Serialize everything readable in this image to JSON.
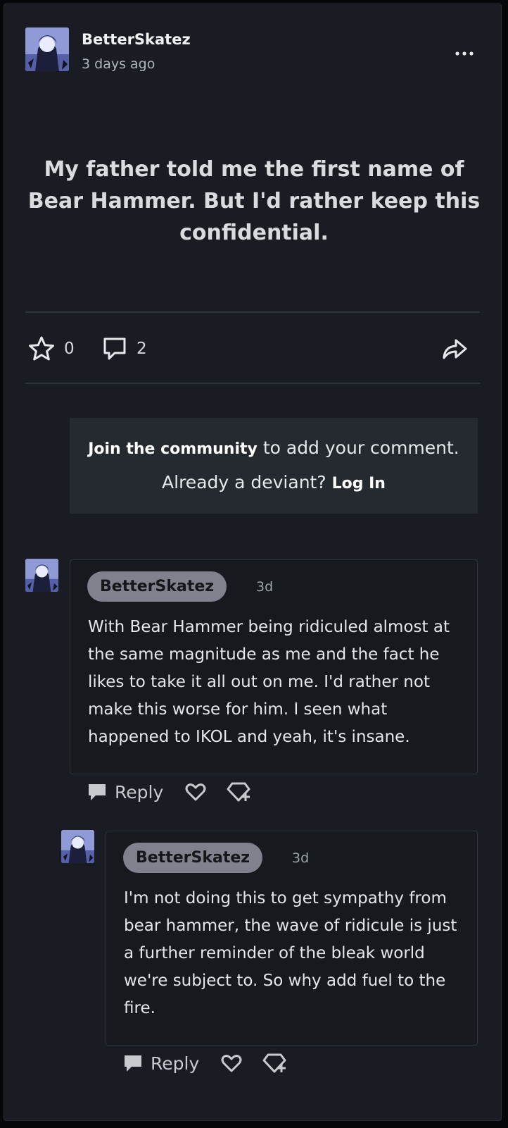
{
  "post": {
    "author": "BetterSkatez",
    "timestamp": "3 days ago",
    "body": "My father told me the first name of Bear Hammer. But I'd rather keep this confidential.",
    "favorites_count": "0",
    "comments_count": "2",
    "icons": {
      "more": "more-dots-icon",
      "favorite": "star-icon",
      "comments": "comment-bubble-icon",
      "share": "share-arrow-icon"
    }
  },
  "join": {
    "link_text": "Join the community",
    "middle_text": "to add your comment. Already a deviant?",
    "login_text": "Log In"
  },
  "comments": [
    {
      "author": "BetterSkatez",
      "time": "3d",
      "text": "With Bear Hammer being ridiculed almost at the same magnitude as me and the fact he likes to take it all out on me. I'd rather not make this worse for him. I seen what happened to IKOL and yeah, it's insane.",
      "reply_label": "Reply"
    },
    {
      "author": "BetterSkatez",
      "time": "3d",
      "text": "I'm not doing this to get sympathy from bear hammer, the wave of ridicule is just a further reminder of the bleak world we're subject to. So why add fuel to the fire.",
      "reply_label": "Reply"
    }
  ],
  "colors": {
    "background": "#191c22",
    "join_box": "#252a30",
    "name_pill": "#7f828c"
  }
}
